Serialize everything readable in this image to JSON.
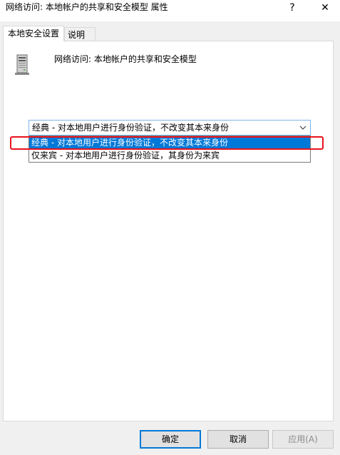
{
  "window": {
    "title": "网络访问: 本地帐户的共享和安全模型 属性",
    "help_glyph": "?",
    "close_glyph": "✕"
  },
  "tabs": [
    {
      "label": "本地安全设置",
      "active": true
    },
    {
      "label": "说明",
      "active": false
    }
  ],
  "policy": {
    "name": "网络访问: 本地帐户的共享和安全模型",
    "icon": "server-computer-icon"
  },
  "combo": {
    "selected": "经典 - 对本地用户进行身份验证，不改变其本来身份",
    "options": [
      "经典 - 对本地用户进行身份验证，不改变其本来身份",
      "仅来宾 - 对本地用户进行身份验证，其身份为来宾"
    ]
  },
  "buttons": {
    "ok": "确定",
    "cancel": "取消",
    "apply": "应用(A)"
  },
  "colors": {
    "selection": "#0078d7",
    "highlight_box": "#e8121c",
    "dialog_bg": "#f0f0f0"
  }
}
